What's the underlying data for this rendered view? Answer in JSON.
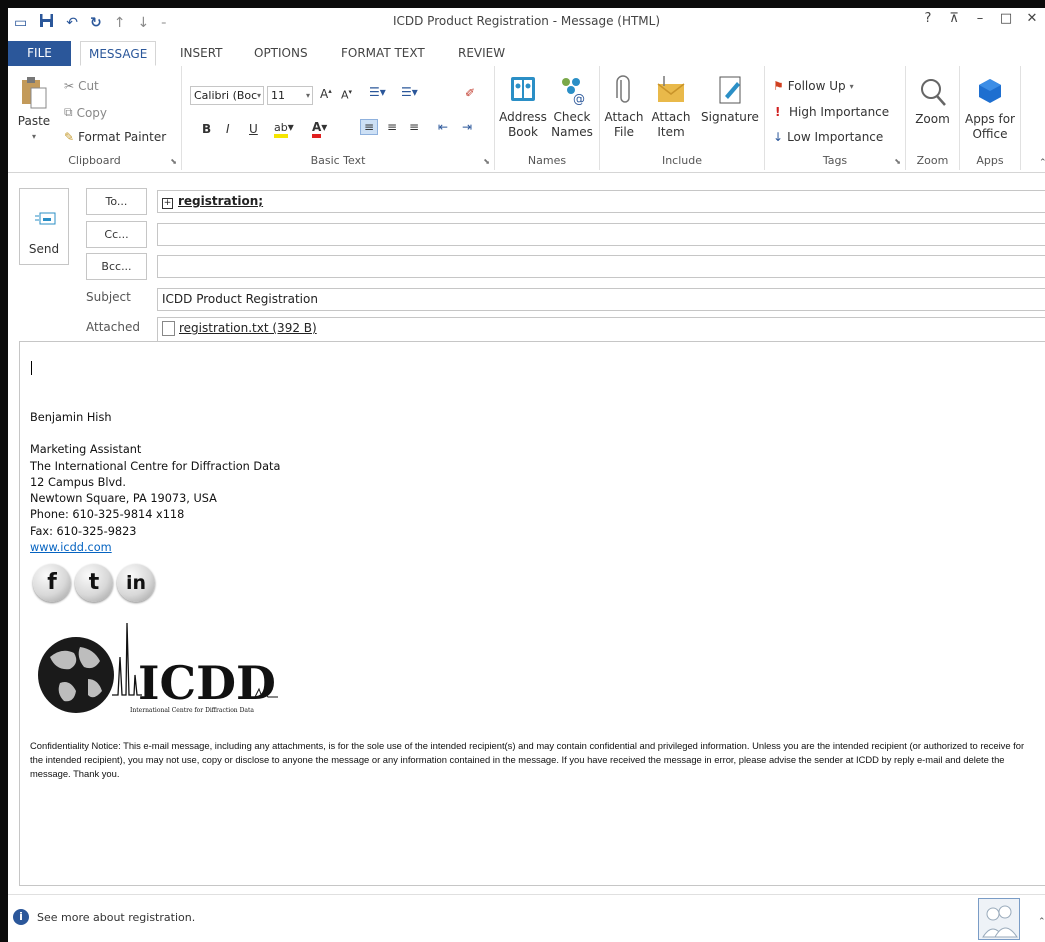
{
  "window": {
    "title": "ICDD Product Registration - Message (HTML)",
    "controls": {
      "help": "?",
      "ribbon_options": "⊼",
      "minimize": "–",
      "maximize": "□",
      "close": "✕"
    }
  },
  "tabs": [
    "FILE",
    "MESSAGE",
    "INSERT",
    "OPTIONS",
    "FORMAT TEXT",
    "REVIEW"
  ],
  "ribbon": {
    "clipboard": {
      "label": "Clipboard",
      "paste": "Paste",
      "cut": "Cut",
      "copy": "Copy",
      "format_painter": "Format Painter"
    },
    "basic_text": {
      "label": "Basic Text",
      "font": "Calibri (Boc",
      "size": "11",
      "bold": "B",
      "italic": "I",
      "underline": "U"
    },
    "names": {
      "label": "Names",
      "address_book": "Address Book",
      "check_names": "Check Names"
    },
    "include": {
      "label": "Include",
      "attach_file": "Attach File",
      "attach_item": "Attach Item",
      "signature": "Signature"
    },
    "tags": {
      "label": "Tags",
      "follow_up": "Follow Up",
      "high_importance": "High Importance",
      "low_importance": "Low Importance"
    },
    "zoom": {
      "label": "Zoom",
      "zoom": "Zoom"
    },
    "apps": {
      "label": "Apps",
      "apps_for_office": "Apps for Office"
    }
  },
  "message": {
    "send": "Send",
    "to_button": "To...",
    "cc_button": "Cc...",
    "bcc_button": "Bcc...",
    "to_value": "registration;",
    "cc_value": "",
    "bcc_value": "",
    "subject_label": "Subject",
    "subject": "ICDD Product Registration",
    "attached_label": "Attached",
    "attachment": "registration.txt (392 B)"
  },
  "body": {
    "signature_name": "Benjamin Hish",
    "signature_title": "Marketing Assistant",
    "org": "The International Centre for Diffraction Data",
    "address1": "12 Campus Blvd.",
    "address2": "Newtown Square, PA 19073, USA",
    "phone": "Phone:  610-325-9814 x118",
    "fax": "Fax:  610-325-9823",
    "website": "www.icdd.com",
    "social": [
      "f",
      "t",
      "in"
    ],
    "logo_text": "ICDD",
    "logo_subtitle": "International Centre for Diffraction Data",
    "confidentiality": "Confidentiality Notice: This e-mail message, including any attachments, is for the sole use of the intended recipient(s) and may contain confidential and privileged information. Unless you are the intended recipient (or authorized to receive for the intended recipient), you may not use, copy or disclose to anyone the message or any information contained in the message. If you have received the message in error, please advise the sender at ICDD by reply e-mail and delete the message. Thank you."
  },
  "footer": {
    "info": "See more about registration."
  },
  "colors": {
    "accent": "#2b579a",
    "link": "#0563c1"
  }
}
